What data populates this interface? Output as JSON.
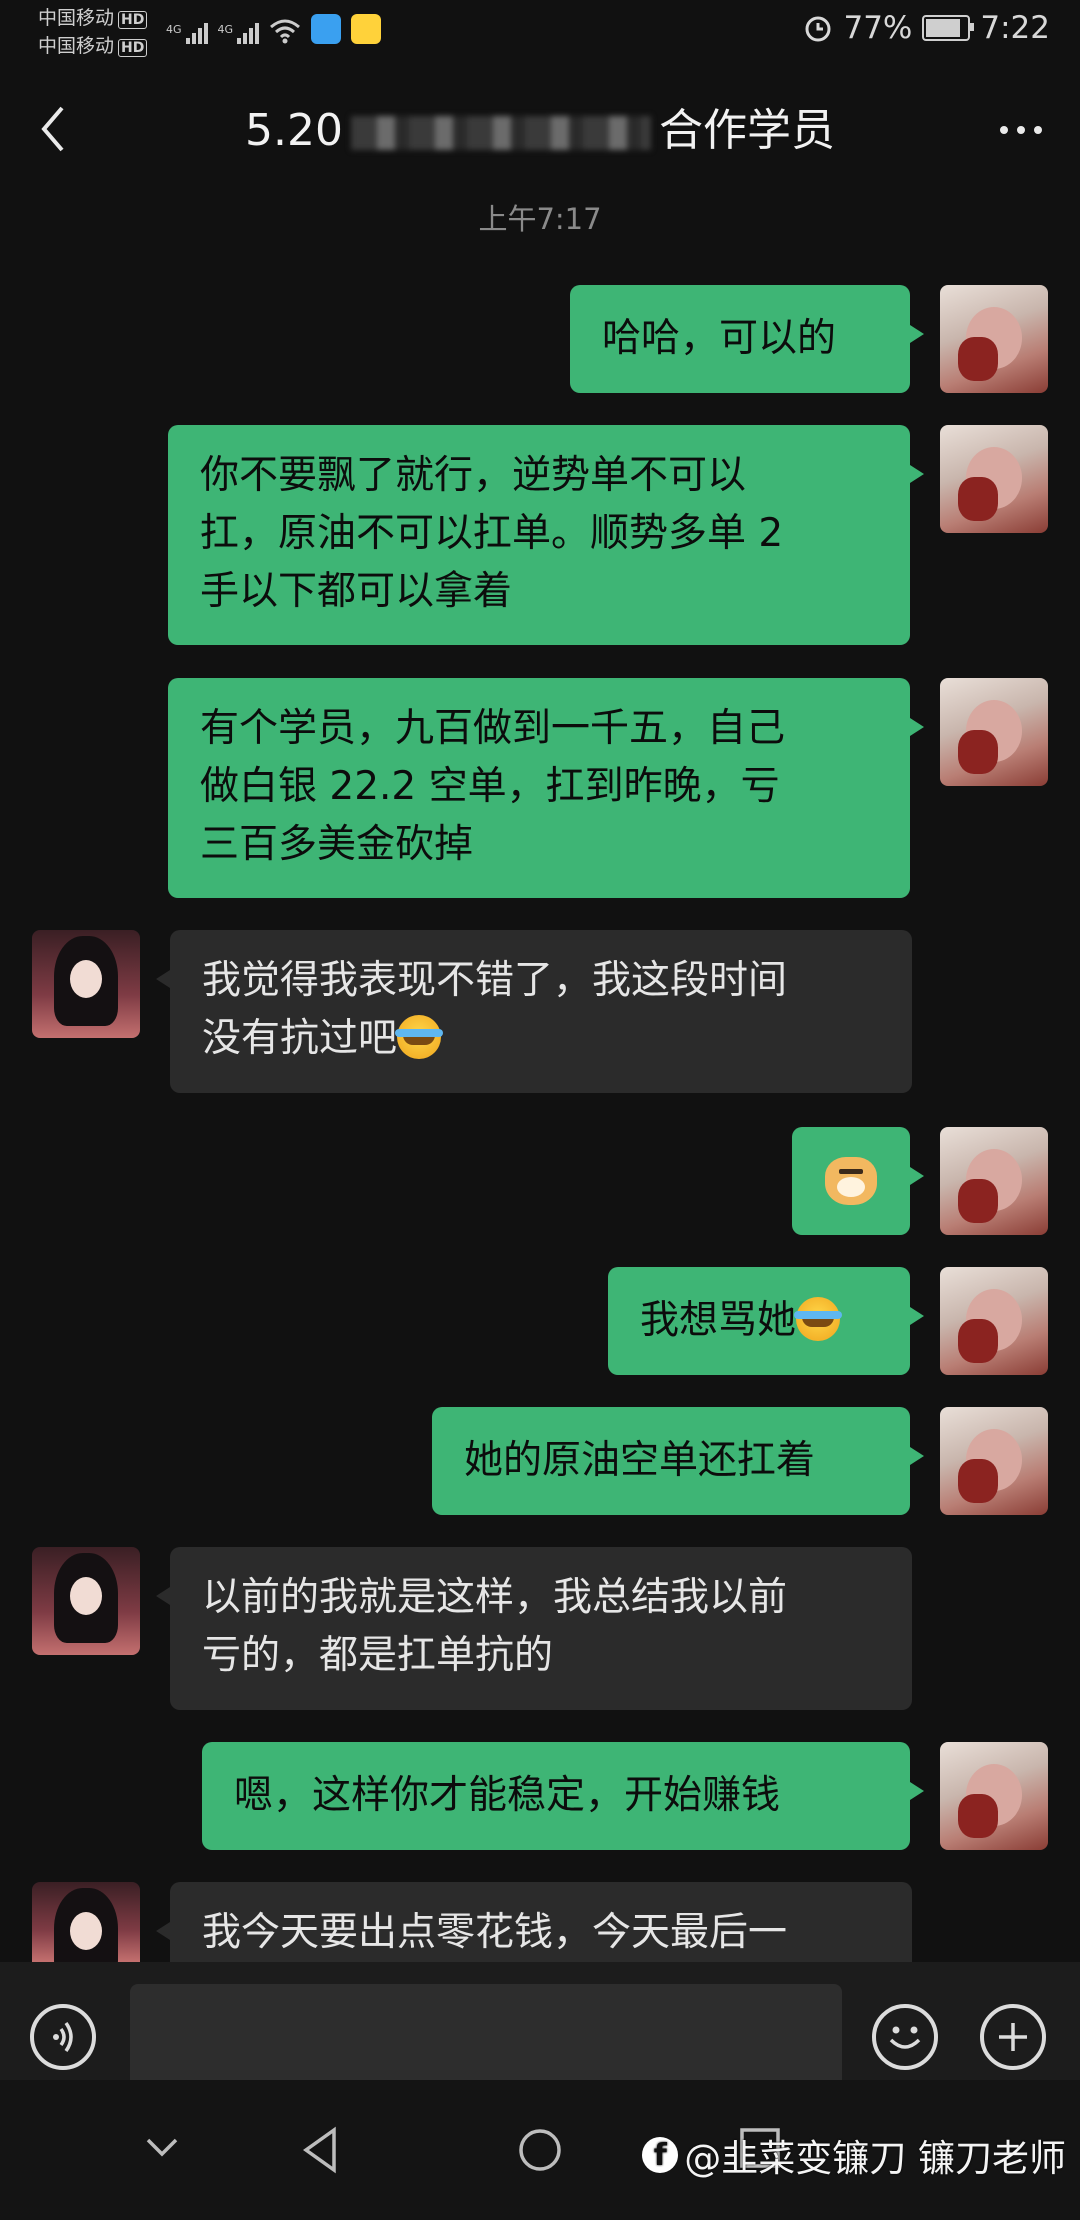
{
  "status_bar": {
    "carrier1": "中国移动",
    "carrier2": "中国移动",
    "hd": "HD",
    "net1": "4G",
    "net2": "4G",
    "battery_pct": "77%",
    "battery_level": 0.77,
    "time": "7:22",
    "icons": [
      "alarm-icon",
      "wifi-icon",
      "qq-browser-icon",
      "weibo-icon"
    ]
  },
  "header": {
    "title_start": "5.20",
    "title_end": "合作学员"
  },
  "timestamp": "上午7:17",
  "messages": [
    {
      "side": "right",
      "text": "哈哈，可以的"
    },
    {
      "side": "right",
      "lines": [
        "你不要飘了就行，逆势单不可以",
        "扛，原油不可以扛单。顺势多单 2",
        "手以下都可以拿着"
      ]
    },
    {
      "side": "right",
      "lines": [
        "有个学员，九百做到一千五，自己",
        "做白银 22.2 空单，扛到昨晚，亏",
        "三百多美金砍掉"
      ]
    },
    {
      "side": "left",
      "lines": [
        "我觉得我表现不错了，我这段时间",
        "没有抗过吧"
      ]
    },
    {
      "side": "right",
      "text": "[doge]"
    },
    {
      "side": "right",
      "text": "我想骂她"
    },
    {
      "side": "right",
      "text": "她的原油空单还扛着"
    },
    {
      "side": "left",
      "lines": [
        "以前的我就是这样，我总结我以前",
        "亏的，都是扛单抗的"
      ]
    },
    {
      "side": "right",
      "text": "嗯，这样你才能稳定，开始赚钱"
    },
    {
      "side": "left",
      "lines": [
        "我今天要出点零花钱，今天最后一"
      ]
    }
  ],
  "input": {
    "value": ""
  },
  "watermark": "@韭菜变镰刀 镰刀老师",
  "colors": {
    "bubble_green": "#3eb575",
    "bubble_dark": "#2b2b2b",
    "background": "#111111"
  }
}
